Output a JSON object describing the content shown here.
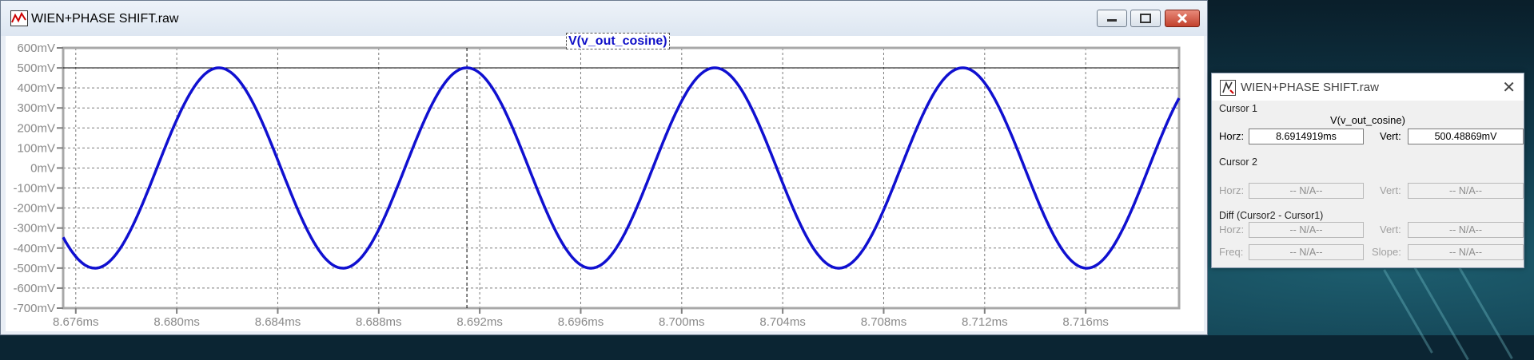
{
  "window": {
    "title": "WIEN+PHASE SHIFT.raw",
    "trace_label": "V(v_out_cosine)"
  },
  "chart_data": {
    "type": "line",
    "title": "V(v_out_cosine)",
    "xlabel": "",
    "ylabel": "",
    "xlim": [
      8.6755,
      8.7197
    ],
    "ylim": [
      -700,
      600
    ],
    "x_unit": "ms",
    "y_unit": "mV",
    "xticks": [
      "8.676ms",
      "8.680ms",
      "8.684ms",
      "8.688ms",
      "8.692ms",
      "8.696ms",
      "8.700ms",
      "8.704ms",
      "8.708ms",
      "8.712ms",
      "8.716ms"
    ],
    "xtick_values": [
      8.676,
      8.68,
      8.684,
      8.688,
      8.692,
      8.696,
      8.7,
      8.704,
      8.708,
      8.712,
      8.716
    ],
    "yticks": [
      "600mV",
      "500mV",
      "400mV",
      "300mV",
      "200mV",
      "100mV",
      "0mV",
      "-100mV",
      "-200mV",
      "-300mV",
      "-400mV",
      "-500mV",
      "-600mV",
      "-700mV"
    ],
    "ytick_values": [
      600,
      500,
      400,
      300,
      200,
      100,
      0,
      -100,
      -200,
      -300,
      -400,
      -500,
      -600,
      -700
    ],
    "grid": true,
    "series": [
      {
        "name": "V(v_out_cosine)",
        "color": "#1010d0",
        "amplitude_mV": 500.5,
        "period_ms": 0.00982,
        "peak_at_ms": 8.69149
      }
    ],
    "cursor": {
      "x": 8.6914919,
      "y": 500.48869
    }
  },
  "cursor_dialog": {
    "title": "WIEN+PHASE SHIFT.raw",
    "cursor1_label": "Cursor 1",
    "trace_name": "V(v_out_cosine)",
    "horz_label": "Horz:",
    "vert_label": "Vert:",
    "cursor1_horz": "8.6914919ms",
    "cursor1_vert": "500.48869mV",
    "cursor2_label": "Cursor 2",
    "cursor2_horz": "-- N/A--",
    "cursor2_vert": "-- N/A--",
    "diff_label": "Diff (Cursor2 - Cursor1)",
    "diff_horz": "-- N/A--",
    "diff_vert": "-- N/A--",
    "freq_label": "Freq:",
    "freq": "-- N/A--",
    "slope_label": "Slope:",
    "slope": "-- N/A--"
  }
}
